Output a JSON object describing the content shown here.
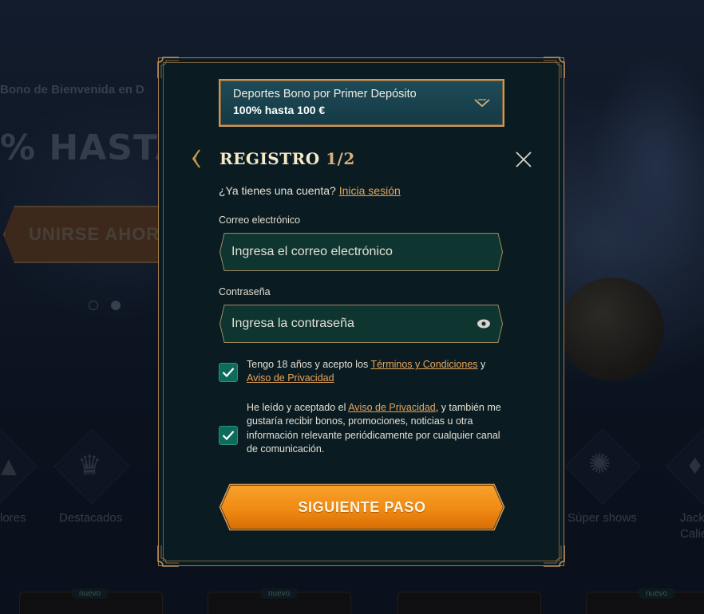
{
  "background": {
    "hero_subtitle": "Bono de Bienvenida en D",
    "hero_title": "% HASTA",
    "join_button": "UNIRSE AHOR",
    "categories": [
      {
        "label": "lores",
        "icon": "pyramid-icon"
      },
      {
        "label": "Destacados",
        "icon": "crown-icon"
      },
      {
        "label": "Súper shows",
        "icon": "wheel-icon"
      },
      {
        "label": "Jack",
        "label2": "Calie",
        "icon": "fire-icon"
      }
    ],
    "badge_new": "nuevo"
  },
  "modal": {
    "bonus": {
      "title": "Deportes Bono por Primer Depósito",
      "value": "100% hasta 100 €"
    },
    "title": "REGISTRO ",
    "step": "1/2",
    "have_account_text": "¿Ya tienes una cuenta?",
    "login_link": "Inicia sesión",
    "email": {
      "label": "Correo electrónico",
      "placeholder": "Ingresa el correo electrónico"
    },
    "password": {
      "label": "Contraseña",
      "placeholder": "Ingresa la contraseña"
    },
    "terms": {
      "checked": true,
      "text_before": "Tengo 18 años y acepto los ",
      "terms_link": "Términos y Condiciones",
      "text_mid": " y",
      "privacy_link": "Aviso de Privacidad"
    },
    "marketing": {
      "checked": true,
      "text_before": "He leído y aceptado el ",
      "privacy_link": "Aviso de Privacidad",
      "text_after": ", y también me gustaría recibir bonos, promociones, noticias u otra información relevante periódicamente por cualquier canal de comunicación."
    },
    "submit_label": "SIGUIENTE PASO"
  },
  "colors": {
    "accent_gold": "#c79a5c",
    "link_orange": "#e8a35a",
    "button_orange": "#f08a12",
    "checkbox_teal": "#0d6b5c",
    "modal_bg": "#0a1c22"
  }
}
